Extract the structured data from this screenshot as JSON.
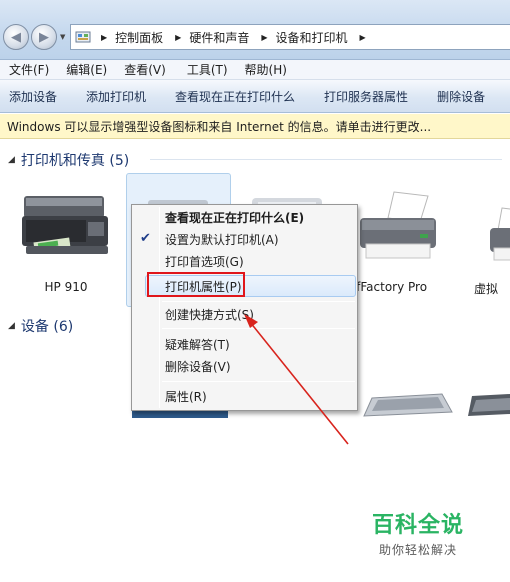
{
  "address": {
    "breadcrumbs": [
      "控制面板",
      "硬件和声音",
      "设备和打印机"
    ]
  },
  "menu": [
    "文件(F)",
    "编辑(E)",
    "查看(V)",
    "工具(T)",
    "帮助(H)"
  ],
  "commands": [
    "添加设备",
    "添加打印机",
    "查看现在正在打印什么",
    "打印服务器属性",
    "删除设备"
  ],
  "infobar": "Windows 可以显示增强型设备图标和来自 Internet 的信息。请单击进行更改...",
  "groups": {
    "printers": "打印机和传真 (5)",
    "devices": "设备 (6)"
  },
  "printers": [
    "HP 910",
    "pdfFactory Pro",
    "虚拟"
  ],
  "context_menu": {
    "items": [
      "查看现在正在打印什么(E)",
      "设置为默认打印机(A)",
      "打印首选项(G)",
      "打印机属性(P)",
      "创建快捷方式(S)",
      "疑难解答(T)",
      "删除设备(V)",
      "属性(R)"
    ]
  },
  "watermark": {
    "main": "百科全说",
    "sub": "助你轻松解决"
  }
}
